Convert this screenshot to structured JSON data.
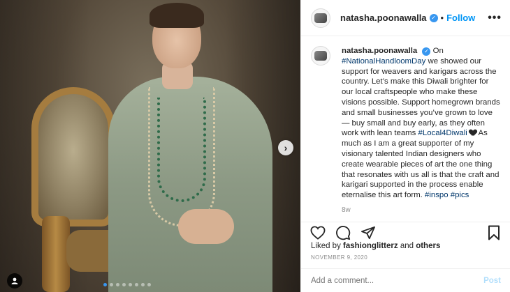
{
  "post": {
    "username": "natasha.poonawalla",
    "separator": "•",
    "follow_label": "Follow",
    "more_label": "•••",
    "verified_icon": "verified-badge-icon",
    "carousel": {
      "next_glyph": "›",
      "dot_count": 8,
      "active_dot": 0
    }
  },
  "caption": {
    "username": "natasha.poonawalla",
    "p1": " On ",
    "tag1": "#NationalHandloomDay",
    "p2": " we showed our support for weavers and karigars across the country. Let’s make this Diwali brighter for our local craftspeople who make these visions possible. Support homegrown brands and small businesses you’ve grown to love — buy small and buy early, as they often work with lean teams ",
    "tag2": "#Local4Diwali",
    "p3": " As much as I am a great supporter of my visionary talented Indian designers who create wearable pieces of art the one thing that resonates with us all is that the craft and karigari supported in the process enable eternalise this art form. ",
    "tag3": "#inspo",
    "tag4": "#pics",
    "time_ago": "8w"
  },
  "likes": {
    "prefix": "Liked by ",
    "user": "fashionglitterz",
    "middle": " and ",
    "others": "others"
  },
  "date": "NOVEMBER 9, 2020",
  "comment": {
    "placeholder": "Add a comment...",
    "post_label": "Post"
  },
  "colors": {
    "accent": "#0095f6",
    "hashtag": "#00376b",
    "muted": "#8e8e8e"
  }
}
